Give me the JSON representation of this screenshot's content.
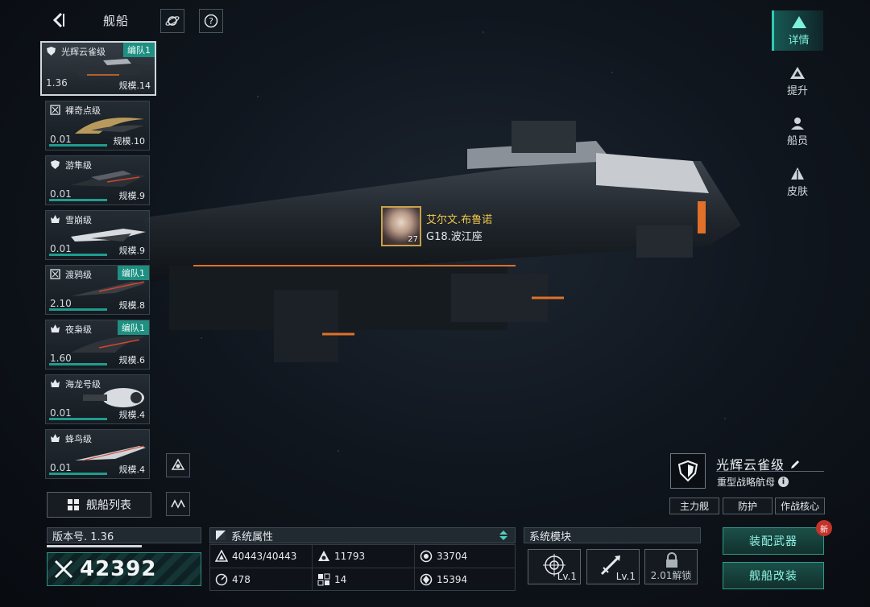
{
  "header": {
    "title": "舰船"
  },
  "ship_list": [
    {
      "name": "光辉云雀级",
      "version": "1.36",
      "scale": "规模.14",
      "team": "编队1",
      "icon": "shield-icon"
    },
    {
      "name": "裸奇点级",
      "version": "0.01",
      "scale": "规模.10",
      "team": "",
      "icon": "target-icon"
    },
    {
      "name": "游隼级",
      "version": "0.01",
      "scale": "规模.9",
      "team": "",
      "icon": "shield-icon"
    },
    {
      "name": "雪崩级",
      "version": "0.01",
      "scale": "规模.9",
      "team": "",
      "icon": "flame-icon"
    },
    {
      "name": "渡鸦级",
      "version": "2.10",
      "scale": "规模.8",
      "team": "编队1",
      "icon": "target-icon"
    },
    {
      "name": "夜枭级",
      "version": "1.60",
      "scale": "规模.6",
      "team": "编队1",
      "icon": "flame-icon"
    },
    {
      "name": "海龙号级",
      "version": "0.01",
      "scale": "规模.4",
      "team": "",
      "icon": "flame-icon"
    },
    {
      "name": "蜂鸟级",
      "version": "0.01",
      "scale": "规模.4",
      "team": "",
      "icon": "flame-icon"
    }
  ],
  "list_button": "舰船列表",
  "right_tabs": [
    {
      "label": "详情",
      "icon": "details-icon",
      "active": true
    },
    {
      "label": "提升",
      "icon": "upgrade-icon",
      "active": false
    },
    {
      "label": "船员",
      "icon": "crew-icon",
      "active": false
    },
    {
      "label": "皮肤",
      "icon": "skin-icon",
      "active": false
    }
  ],
  "commander": {
    "name": "艾尔文.布鲁诺",
    "location": "G18.波江座",
    "level": "27"
  },
  "ship_info": {
    "name": "光辉云雀级",
    "class": "重型战略航母",
    "tags": [
      "主力舰",
      "防护",
      "作战核心"
    ]
  },
  "version": {
    "label": "版本号. 1.36",
    "power": "42392"
  },
  "attributes": {
    "title": "系统属性",
    "items": [
      {
        "icon": "hp-icon",
        "value": "40443/40443"
      },
      {
        "icon": "armor-icon",
        "value": "11793"
      },
      {
        "icon": "shield-stat-icon",
        "value": "33704"
      },
      {
        "icon": "speed-icon",
        "value": "478"
      },
      {
        "icon": "dodge-icon",
        "value": "14"
      },
      {
        "icon": "firepower-icon",
        "value": "15394"
      }
    ]
  },
  "modules": {
    "title": "系统模块",
    "items": [
      {
        "icon": "radar-module-icon",
        "level": "Lv.1"
      },
      {
        "icon": "weapon-module-icon",
        "level": "Lv.1"
      },
      {
        "icon": "lock-icon",
        "lock_text": "2.01解锁"
      }
    ]
  },
  "actions": {
    "equip": "装配武器",
    "modify": "舰船改装",
    "new_badge": "新"
  },
  "colors": {
    "accent": "#1f8f82",
    "accent_text": "#8ff5e6",
    "commander_name": "#f0c64a"
  }
}
